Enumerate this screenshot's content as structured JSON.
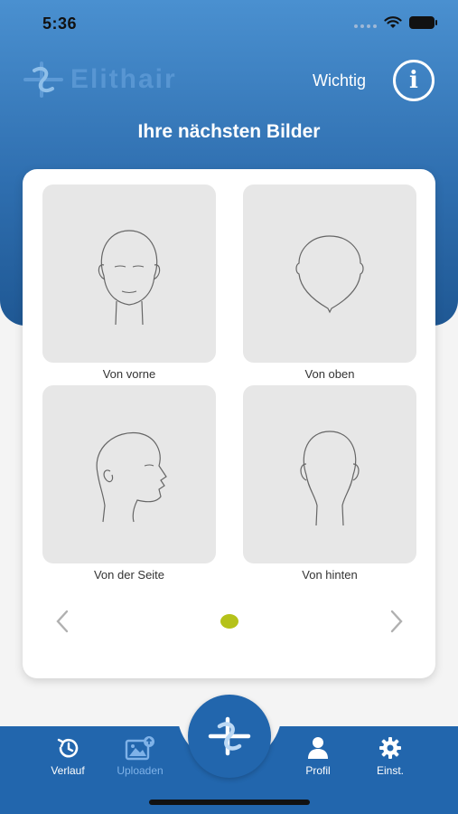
{
  "status": {
    "time": "5:36"
  },
  "header": {
    "logo_text": "Elithair",
    "wichtig_label": "Wichtig",
    "info_label": "i",
    "title": "Ihre nächsten Bilder"
  },
  "tiles": [
    {
      "label": "Von vorne"
    },
    {
      "label": "Von oben"
    },
    {
      "label": "Von der Seite"
    },
    {
      "label": "Von hinten"
    }
  ],
  "pager": {
    "page_count": 1,
    "current_page": 1,
    "dot_color": "#b5c21a"
  },
  "tabbar": {
    "items": [
      {
        "label": "Verlauf",
        "icon": "history-icon"
      },
      {
        "label": "Uploaden",
        "icon": "upload-image-icon"
      },
      {
        "label": "Profil",
        "icon": "profile-icon"
      },
      {
        "label": "Einst.",
        "icon": "settings-icon"
      }
    ]
  },
  "colors": {
    "primary": "#2266ad",
    "header_gradient_top": "#4a90d0",
    "header_gradient_bottom": "#1f5894",
    "accent": "#b5c21a"
  }
}
